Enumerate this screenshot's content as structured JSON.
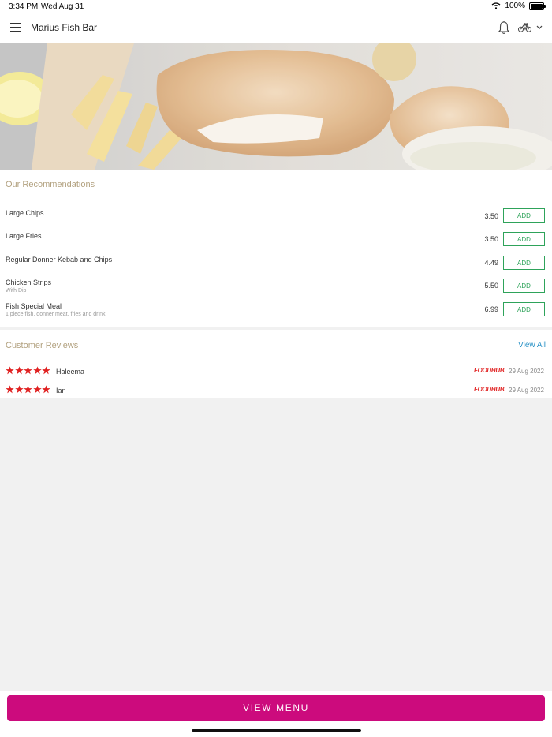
{
  "status_bar": {
    "time": "3:34 PM",
    "date": "Wed Aug 31",
    "battery": "100%"
  },
  "header": {
    "title": "Marius Fish Bar"
  },
  "recommendations": {
    "title": "Our Recommendations",
    "add_label": "ADD",
    "items": [
      {
        "name": "Large Chips",
        "description": "",
        "price": "3.50"
      },
      {
        "name": "Large Fries",
        "description": "",
        "price": "3.50"
      },
      {
        "name": "Regular Donner Kebab and Chips",
        "description": "",
        "price": "4.49"
      },
      {
        "name": "Chicken Strips",
        "description": "With Dip",
        "price": "5.50"
      },
      {
        "name": "Fish Special Meal",
        "description": "1 piece fish, donner meat, fries and drink",
        "price": "6.99"
      }
    ]
  },
  "reviews": {
    "title": "Customer Reviews",
    "view_all": "View All",
    "items": [
      {
        "name": "Haleema",
        "rating": 5,
        "source": "FOODHUB",
        "date": "29 Aug 2022"
      },
      {
        "name": "Ian",
        "rating": 5,
        "source": "FOODHUB",
        "date": "29 Aug 2022"
      }
    ]
  },
  "footer": {
    "view_menu": "VIEW MENU"
  },
  "colors": {
    "accent": "#cc0b7d",
    "add_green": "#2ea35a",
    "section_title": "#b2a17f",
    "star": "#e02020",
    "link": "#2b93c7"
  }
}
